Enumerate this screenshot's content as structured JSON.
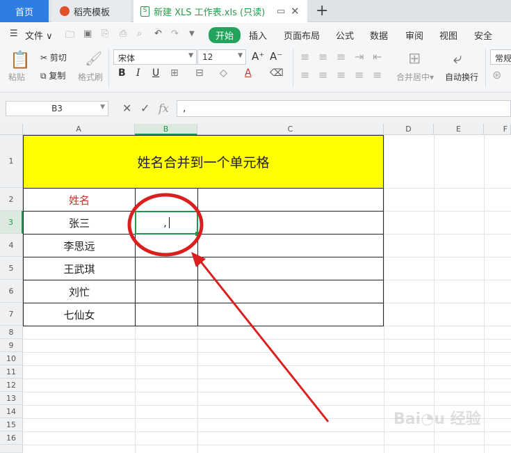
{
  "tabs": {
    "home": "首页",
    "template": "稻壳模板",
    "document": "新建 XLS 工作表.xls (只读)"
  },
  "menu": {
    "file": "文件",
    "items": [
      "开始",
      "插入",
      "页面布局",
      "公式",
      "数据",
      "审阅",
      "视图",
      "安全"
    ]
  },
  "ribbon": {
    "paste": "粘贴",
    "cut": "剪切",
    "copy": "复制",
    "format_painter": "格式刷",
    "font_name": "宋体",
    "font_size": "12",
    "merge_center": "合并居中",
    "wrap_text": "自动换行",
    "number_format": "常规"
  },
  "formula_bar": {
    "name_box": "B3",
    "fx": "fx",
    "content": ","
  },
  "columns": [
    "A",
    "B",
    "C",
    "D",
    "E",
    "F"
  ],
  "rows": [
    "1",
    "2",
    "3",
    "4",
    "5",
    "6",
    "7",
    "8",
    "9",
    "10",
    "11",
    "12",
    "13",
    "14",
    "15",
    "16"
  ],
  "sheet": {
    "title": "姓名合并到一个单元格",
    "header": "姓名",
    "names": [
      "张三",
      "李思远",
      "王武琪",
      "刘忙",
      "七仙女"
    ],
    "b3": ","
  },
  "colors": {
    "accent": "#23a35b",
    "title_fill": "#ffff00",
    "header_text": "#c0392b",
    "annotation": "#d9201f"
  }
}
